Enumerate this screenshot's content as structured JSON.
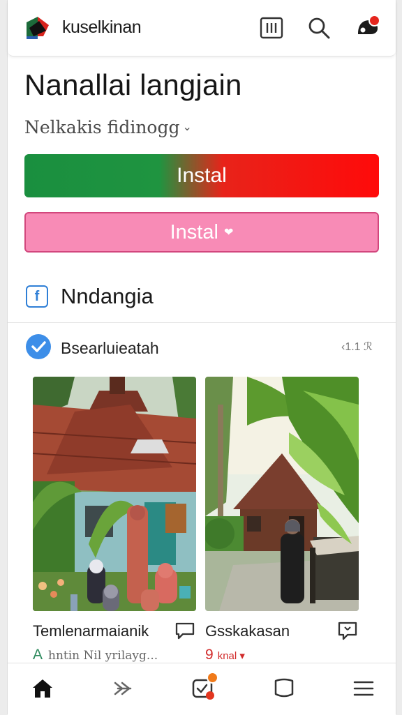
{
  "app": {
    "name": "kuselkinan"
  },
  "header": {
    "icons": [
      "grid-icon",
      "search-icon",
      "notification-icon"
    ]
  },
  "hero": {
    "title": "Nanallai langjain",
    "subtitle": "Nelkakis fidinogg",
    "primary_button": "Instal",
    "secondary_button": "Instal"
  },
  "section": {
    "title": "Nndangia"
  },
  "post": {
    "author": "Bsearluieatah",
    "meta": "‹1.1 ℛ",
    "cards": [
      {
        "caption": "Temlenarmaianik",
        "sub_letter": "A",
        "sub_text": "hntin Nil yrilayg..."
      },
      {
        "caption": "Gsskakasan",
        "sub_number": "9",
        "sub_text": "knal ▾"
      }
    ]
  },
  "colors": {
    "accent_blue": "#2f7fd6",
    "green": "#1a8f3f",
    "red": "#ff0a0a",
    "pink": "#f88bb6",
    "notify": "#e5261e"
  },
  "bottom_nav": [
    "home-icon",
    "forward-icon",
    "checklist-icon",
    "bookmark-icon",
    "menu-icon"
  ]
}
